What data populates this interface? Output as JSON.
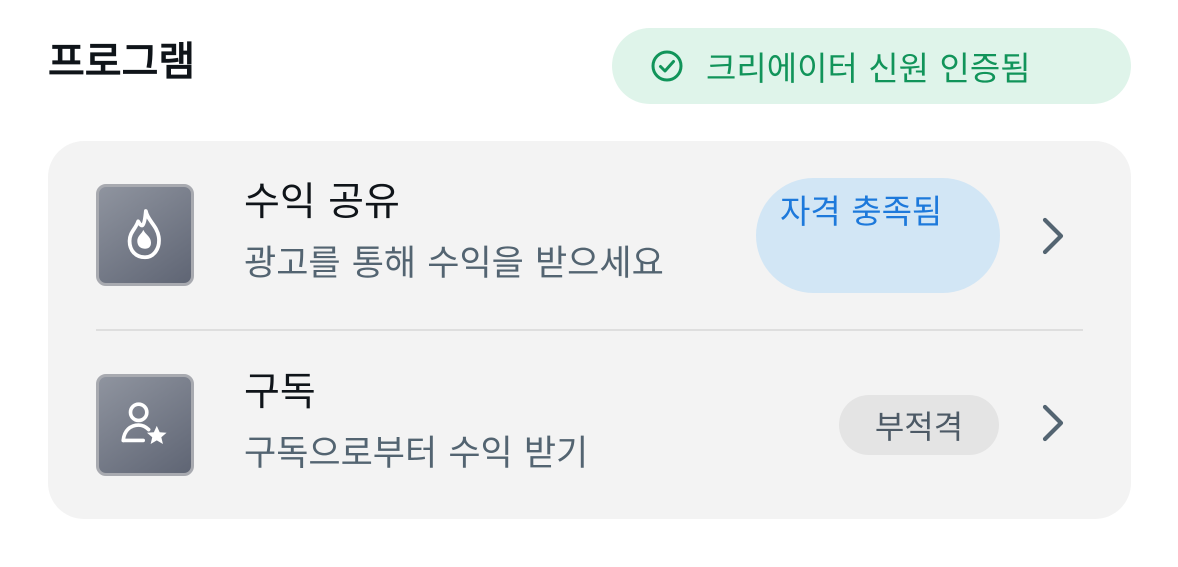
{
  "header": {
    "title": "프로그램",
    "verified_label": "크리에이터 신원 인증됨",
    "verified_icon": "check-circle-icon"
  },
  "programs": [
    {
      "title": "수익 공유",
      "subtitle": "광고를 통해 수익을 받으세요",
      "status": "자격 충족됨",
      "status_state": "eligible",
      "icon": "flame-icon"
    },
    {
      "title": "구독",
      "subtitle": "구독으로부터 수익 받기",
      "status": "부적격",
      "status_state": "ineligible",
      "icon": "person-star-icon"
    }
  ],
  "colors": {
    "verified_bg": "#dff4ea",
    "verified_text": "#11945a",
    "eligible_bg": "#d2e6f5",
    "eligible_text": "#1d79db",
    "ineligible_bg": "#e4e4e4",
    "ineligible_text": "#4d5a66",
    "card_bg": "#f3f3f3"
  }
}
